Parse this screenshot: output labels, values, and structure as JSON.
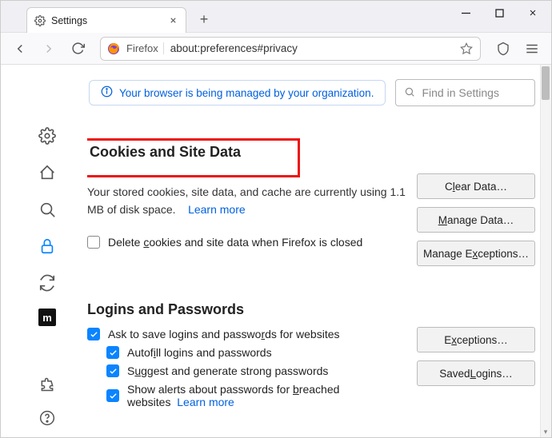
{
  "window": {
    "tab_title": "Settings",
    "newtab_plus": "+"
  },
  "toolbar": {
    "firefox_label": "Firefox",
    "url": "about:preferences#privacy"
  },
  "info_banner": "Your browser is being managed by your organization.",
  "search": {
    "placeholder": "Find in Settings"
  },
  "cookies": {
    "heading": "Cookies and Site Data",
    "body_line1": "Your stored cookies, site data, and cache are currently using 1.1",
    "body_line2": "MB of disk space.",
    "learn_more": "Learn more",
    "delete_on_close": "Delete cookies and site data when Firefox is closed",
    "btn_clear": "Clear Data…",
    "btn_manage": "Manage Data…",
    "btn_exceptions": "Manage Exceptions…"
  },
  "logins": {
    "heading": "Logins and Passwords",
    "ask_save": "Ask to save logins and passwords for websites",
    "autofill": "Autofill logins and passwords",
    "suggest": "Suggest and generate strong passwords",
    "breach": "Show alerts about passwords for breached websites",
    "learn_more": "Learn more",
    "btn_exceptions": "Exceptions…",
    "btn_saved": "Saved Logins…"
  }
}
